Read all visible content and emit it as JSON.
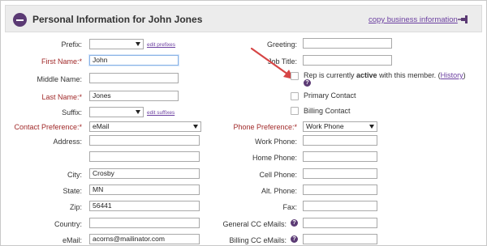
{
  "header": {
    "title": "Personal Information for John Jones",
    "copy_link": "copy business information"
  },
  "left": {
    "prefix_label": "Prefix:",
    "prefix_value": "",
    "edit_prefixes": "edit prefixes",
    "first_name_label": "First Name:*",
    "first_name_value": "John",
    "middle_name_label": "Middle Name:",
    "middle_name_value": "",
    "last_name_label": "Last Name:*",
    "last_name_value": "Jones",
    "suffix_label": "Suffix:",
    "suffix_value": "",
    "edit_suffixes": "edit suffixes",
    "contact_pref_label": "Contact Preference:*",
    "contact_pref_value": "eMail",
    "address_label": "Address:",
    "address1_value": "",
    "address2_value": "",
    "city_label": "City:",
    "city_value": "Crosby",
    "state_label": "State:",
    "state_value": "MN",
    "zip_label": "Zip:",
    "zip_value": "56441",
    "country_label": "Country:",
    "country_value": "",
    "email_label": "eMail:",
    "email_value": "acorns@mailinator.com"
  },
  "right": {
    "greeting_label": "Greeting:",
    "greeting_value": "",
    "job_title_label": "Job Title:",
    "job_title_value": "",
    "rep_text_pre": "Rep is currently ",
    "rep_text_bold": "active",
    "rep_text_post": " with this member. (",
    "history_link": "History",
    "rep_text_close": ")",
    "rep_checked": false,
    "primary_contact_label": "Primary Contact",
    "primary_contact_checked": false,
    "billing_contact_label": "Billing Contact",
    "billing_contact_checked": false,
    "phone_pref_label": "Phone Preference:*",
    "phone_pref_value": "Work Phone",
    "work_phone_label": "Work Phone:",
    "work_phone_value": "",
    "home_phone_label": "Home Phone:",
    "home_phone_value": "",
    "cell_phone_label": "Cell Phone:",
    "cell_phone_value": "",
    "alt_phone_label": "Alt. Phone:",
    "alt_phone_value": "",
    "fax_label": "Fax:",
    "fax_value": "",
    "general_cc_label": "General CC eMails:",
    "general_cc_value": "",
    "billing_cc_label": "Billing CC eMails:",
    "billing_cc_value": ""
  },
  "icons": {
    "help": "?",
    "help_icon": "question-circle-icon",
    "pin_icon": "pushpin-icon",
    "collapse_icon": "minus-circle-icon"
  },
  "colors": {
    "accent": "#5b3a74",
    "link": "#6b3fa0",
    "required": "#a12a2a",
    "arrow": "#d64545"
  }
}
